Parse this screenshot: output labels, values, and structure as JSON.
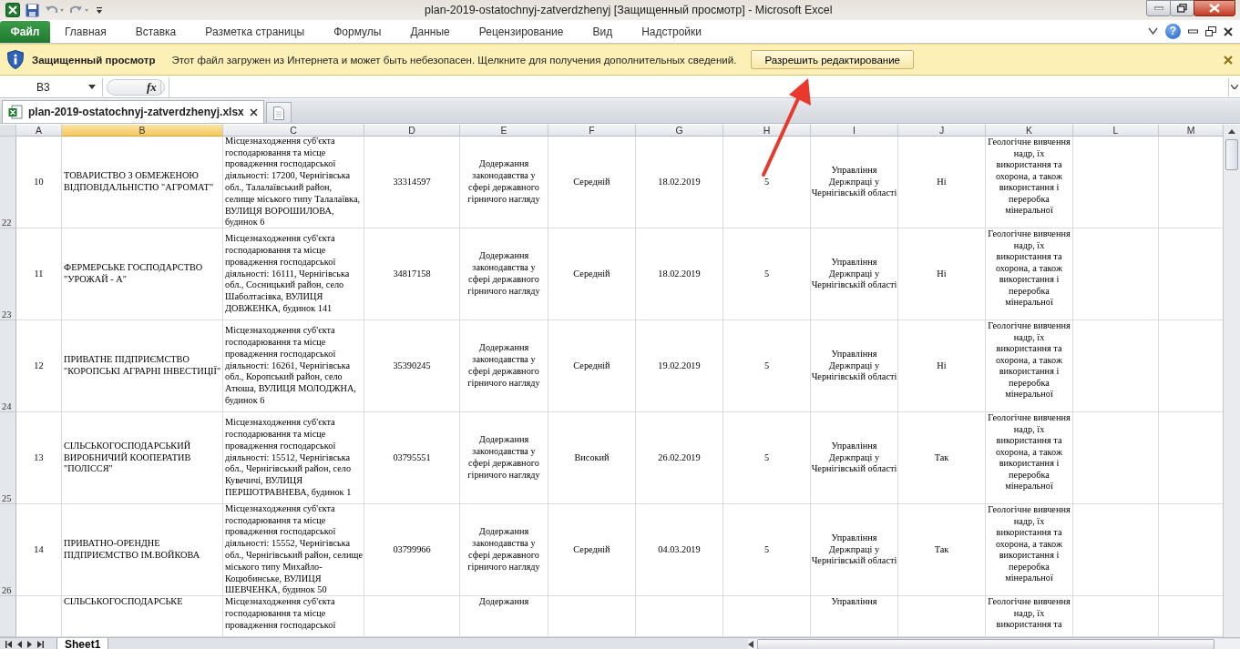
{
  "window": {
    "title": "plan-2019-ostatochnyj-zatverdzhenyj  [Защищенный просмотр]  -  Microsoft Excel"
  },
  "ribbon": {
    "file_tab": "Файл",
    "tabs": [
      "Главная",
      "Вставка",
      "Разметка страницы",
      "Формулы",
      "Данные",
      "Рецензирование",
      "Вид",
      "Надстройки"
    ],
    "help": "?"
  },
  "protected_view": {
    "title": "Защищенный просмотр",
    "message": "Этот файл загружен из Интернета и может быть небезопасен. Щелкните для получения дополнительных сведений.",
    "button": "Разрешить редактирование"
  },
  "formula_bar": {
    "name_box": "B3",
    "fx": "fx"
  },
  "document_tab": {
    "label": "plan-2019-ostatochnyj-zatverdzhenyj.xlsx"
  },
  "sheet": {
    "columns": [
      {
        "label": "A",
        "selected": false
      },
      {
        "label": "B",
        "selected": true
      },
      {
        "label": "C",
        "selected": false
      },
      {
        "label": "D",
        "selected": false
      },
      {
        "label": "E",
        "selected": false
      },
      {
        "label": "F",
        "selected": false
      },
      {
        "label": "G",
        "selected": false
      },
      {
        "label": "H",
        "selected": false
      },
      {
        "label": "I",
        "selected": false
      },
      {
        "label": "J",
        "selected": false
      },
      {
        "label": "K",
        "selected": false
      },
      {
        "label": "L",
        "selected": false
      },
      {
        "label": "M",
        "selected": false
      }
    ],
    "rows": [
      {
        "number": "22",
        "cells": [
          "10",
          "ТОВАРИСТВО З ОБМЕЖЕНОЮ ВІДПОВІДАЛЬНІСТЮ \"АГРОМАТ\"",
          "Місцезнаходження суб'єкта господарювання та місце провадження господарської діяльності: 17200, Чернігівська обл., Талалаївський район, селище міського типу Талалаївка, ВУЛИЦЯ ВОРОШИЛОВА, будинок 6",
          "33314597",
          "Додержання законодавства у сфері державного гірничого нагляду",
          "Середній",
          "18.02.2019",
          "5",
          "Управління Держпраці у Чернігівській області",
          "Ні",
          "Геологічне вивчення надр, їх використання та охорона, а також використання і переробка мінеральної"
        ]
      },
      {
        "number": "23",
        "cells": [
          "11",
          "ФЕРМЕРСЬКЕ ГОСПОДАРСТВО \"УРОЖАЙ - А\"",
          "Місцезнаходження суб'єкта господарювання та місце провадження господарської діяльності: 16111, Чернігівська обл., Сосницький район, село Шаболтасівка, ВУЛИЦЯ ДОВЖЕНКА, будинок 141",
          "34817158",
          "Додержання законодавства у сфері державного гірничого нагляду",
          "Середній",
          "18.02.2019",
          "5",
          "Управління Держпраці у Чернігівській області",
          "Ні",
          "Геологічне вивчення надр, їх використання та охорона, а також використання і переробка мінеральної"
        ]
      },
      {
        "number": "24",
        "cells": [
          "12",
          "ПРИВАТНЕ ПІДПРИЄМСТВО \"КОРОПСЬКІ АГРАРНІ ІНВЕСТИЦІЇ\"",
          "Місцезнаходження суб'єкта господарювання та місце провадження господарської діяльності: 16261, Чернігівська обл., Коропський район, село Атюша, ВУЛИЦЯ МОЛОДЖНА, будинок 6",
          "35390245",
          "Додержання законодавства у сфері державного гірничого нагляду",
          "Середній",
          "19.02.2019",
          "5",
          "Управління Держпраці у Чернігівській області",
          "Ні",
          "Геологічне вивчення надр, їх використання та охорона, а також використання і переробка мінеральної"
        ]
      },
      {
        "number": "25",
        "cells": [
          "13",
          "СІЛЬСЬКОГОСПОДАРСЬКИЙ ВИРОБНИЧИЙ КООПЕРАТИВ \"ПОЛІССЯ\"",
          "Місцезнаходження суб'єкта господарювання та місце провадження господарської діяльності: 15512, Чернігівська обл., Чернігівський район, село Кувечичі, ВУЛИЦЯ ПЕРШОТРАВНЕВА, будинок 1",
          "03795551",
          "Додержання законодавства у сфері державного гірничого нагляду",
          "Високий",
          "26.02.2019",
          "5",
          "Управління Держпраці у Чернігівській області",
          "Так",
          "Геологічне вивчення надр, їх використання та охорона, а також використання і переробка мінеральної"
        ]
      },
      {
        "number": "26",
        "cells": [
          "14",
          "ПРИВАТНО-ОРЕНДНЕ ПІДПРИЄМСТВО ІМ.ВОЙКОВА",
          "Місцезнаходження суб'єкта господарювання та місце провадження господарської діяльності: 15552, Чернігівська обл., Чернігівський район, селище міського типу Михайло-Коцюбинське, ВУЛИЦЯ ШЕВЧЕНКА, будинок 50",
          "03799966",
          "Додержання законодавства у сфері державного гірничого нагляду",
          "Середній",
          "04.03.2019",
          "5",
          "Управління Держпраці у Чернігівській області",
          "Так",
          "Геологічне вивчення надр, їх використання та охорона, а також використання і переробка мінеральної"
        ]
      },
      {
        "kind": "partial",
        "cells": [
          null,
          "СІЛЬСЬКОГОСПОДАРСЬКЕ",
          "Місцезнаходження суб'єкта господарювання та місце провадження господарської",
          null,
          "Додержання",
          null,
          null,
          null,
          "Управління",
          null,
          "Геологічне вивчення надр, їх використання та"
        ]
      }
    ]
  },
  "sheet_tabs": [
    {
      "label": "Sheet1",
      "selected": true
    }
  ]
}
